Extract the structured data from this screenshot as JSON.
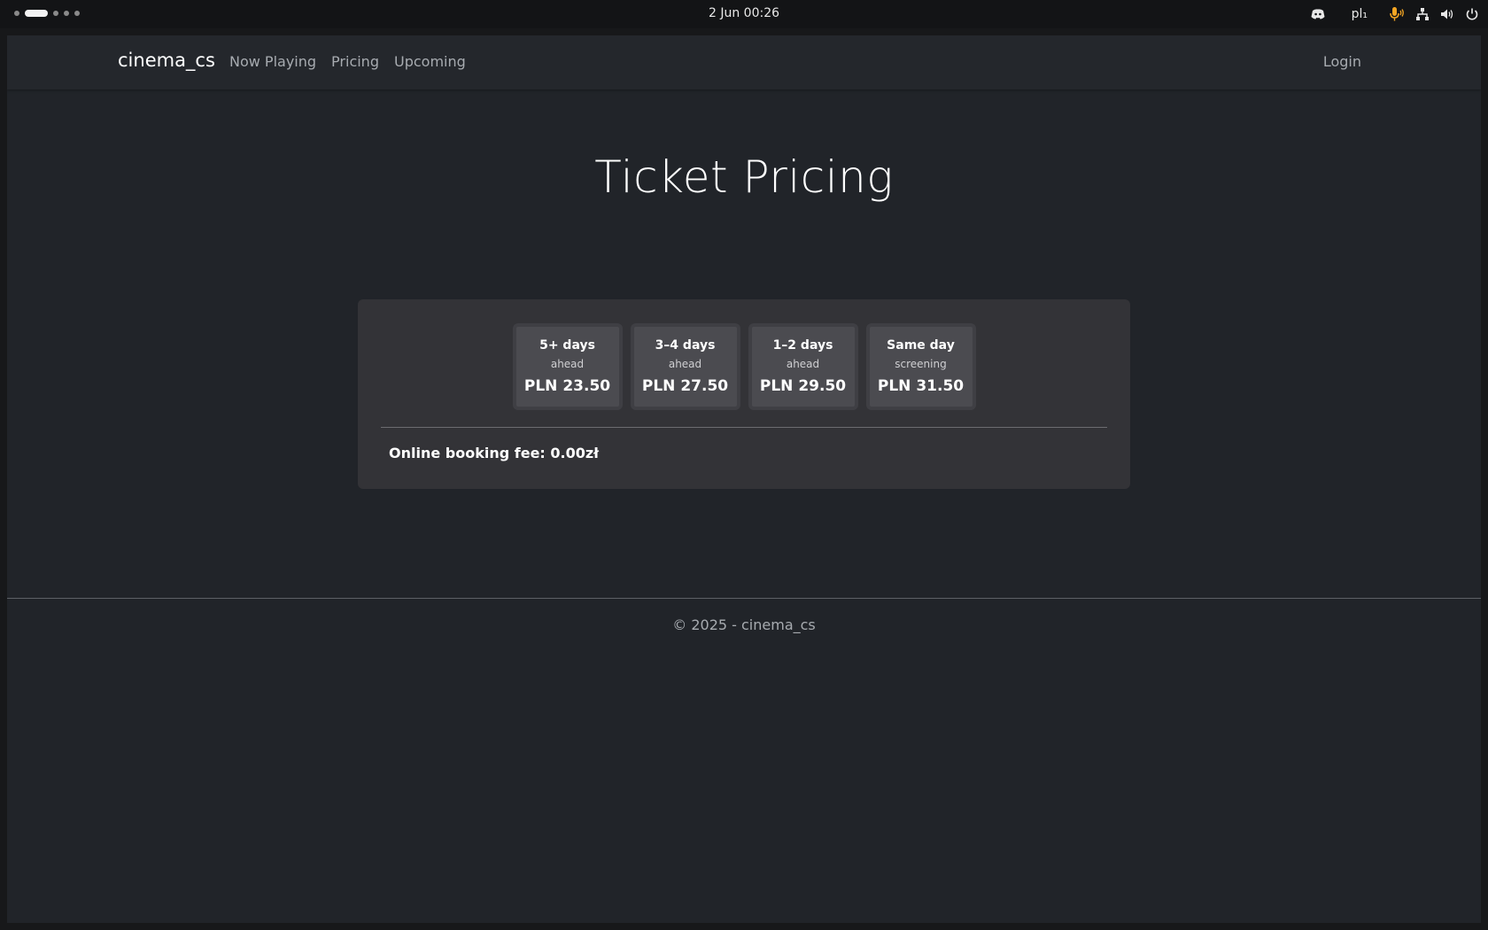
{
  "system_bar": {
    "clock": "2 Jun  00:26",
    "keyboard_layout": "pl₁",
    "icons": [
      "discord-icon",
      "microphone-icon",
      "network-icon",
      "volume-icon",
      "power-icon"
    ]
  },
  "navbar": {
    "brand": "cinema_cs",
    "links": [
      "Now Playing",
      "Pricing",
      "Upcoming"
    ],
    "login": "Login"
  },
  "page": {
    "title": "Ticket Pricing"
  },
  "pricing": {
    "tiers": [
      {
        "title": "5+ days",
        "subtitle": "ahead",
        "price": "PLN 23.50"
      },
      {
        "title": "3–4 days",
        "subtitle": "ahead",
        "price": "PLN 27.50"
      },
      {
        "title": "1–2 days",
        "subtitle": "ahead",
        "price": "PLN 29.50"
      },
      {
        "title": "Same day",
        "subtitle": "screening",
        "price": "PLN 31.50"
      }
    ],
    "booking_fee": "Online booking fee: 0.00zł"
  },
  "footer": {
    "text": "© 2025 - cinema_cs"
  },
  "colors": {
    "mic_accent": "#f5a623",
    "page_bg": "#212429",
    "card_bg": "#333337"
  }
}
